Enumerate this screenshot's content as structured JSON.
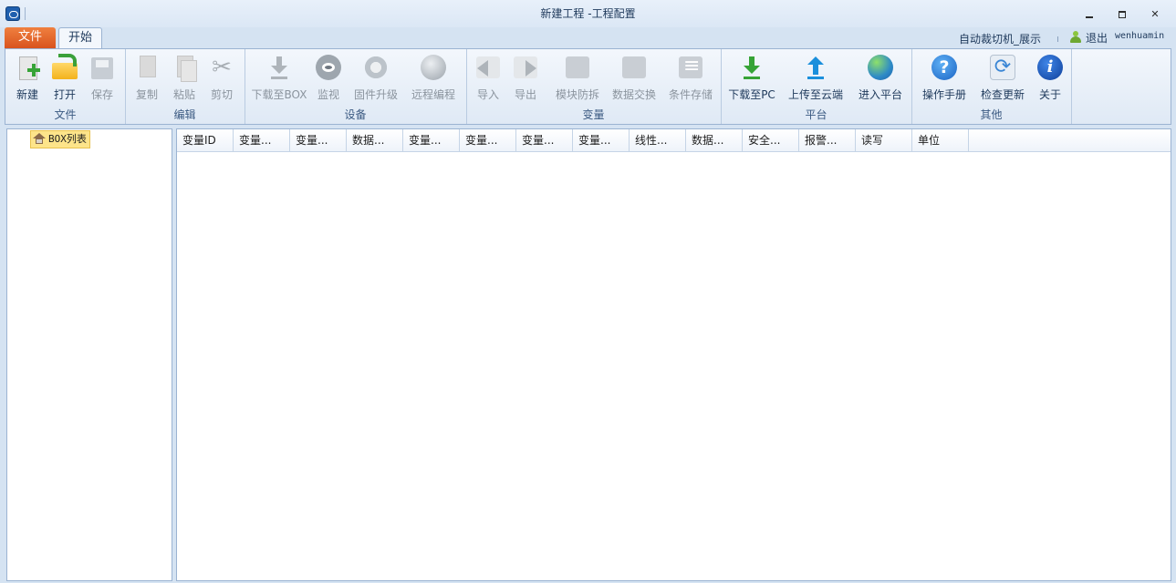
{
  "window": {
    "title": "新建工程 -工程配置",
    "minimize": "—",
    "maximize": "▢",
    "close": "✕"
  },
  "tabs": {
    "file": "文件",
    "start": "开始"
  },
  "header_right": {
    "device": "自动裁切机_展示",
    "logout": "退出",
    "username": "wenhuamin"
  },
  "ribbon": {
    "groups": {
      "file": "文件",
      "edit": "编辑",
      "device": "设备",
      "variable": "变量",
      "platform": "平台",
      "other": "其他"
    },
    "buttons": {
      "new": "新建",
      "open": "打开",
      "save": "保存",
      "copy": "复制",
      "paste": "粘贴",
      "cut": "剪切",
      "download_box": "下载至BOX",
      "monitor": "监视",
      "firmware": "固件升级",
      "remote": "远程编程",
      "import": "导入",
      "export": "导出",
      "module": "模块防拆",
      "exchange": "数据交换",
      "condition": "条件存储",
      "download_pc": "下载至PC",
      "upload_cloud": "上传至云端",
      "enter_platform": "进入平台",
      "manual": "操作手册",
      "update": "检查更新",
      "about": "关于"
    },
    "icons": {
      "new": "new-document-icon",
      "open": "open-folder-icon",
      "save": "save-disk-icon",
      "copy": "copy-icon",
      "paste": "paste-icon",
      "cut": "scissors-icon",
      "download_box": "download-icon",
      "monitor": "eye-icon",
      "firmware": "gear-icon",
      "remote": "globe-icon",
      "import": "import-arrow-icon",
      "export": "export-arrow-icon",
      "module": "lock-icon",
      "exchange": "exchange-icon",
      "condition": "list-icon",
      "download_pc": "download-icon",
      "upload_cloud": "upload-icon",
      "enter_platform": "globe-icon",
      "manual": "help-icon",
      "update": "refresh-icon",
      "about": "info-icon"
    }
  },
  "tree": {
    "root": "BOX列表"
  },
  "grid": {
    "columns": [
      "变量ID",
      "变量...",
      "变量...",
      "数据...",
      "变量...",
      "变量...",
      "变量...",
      "变量...",
      "线性...",
      "数据...",
      "安全...",
      "报警...",
      "读写",
      "单位"
    ]
  },
  "colors": {
    "file_tab": "#e4642a",
    "accent_green": "#36a336",
    "accent_blue": "#1a8fdc",
    "ribbon_bg": "#e6eef8"
  }
}
